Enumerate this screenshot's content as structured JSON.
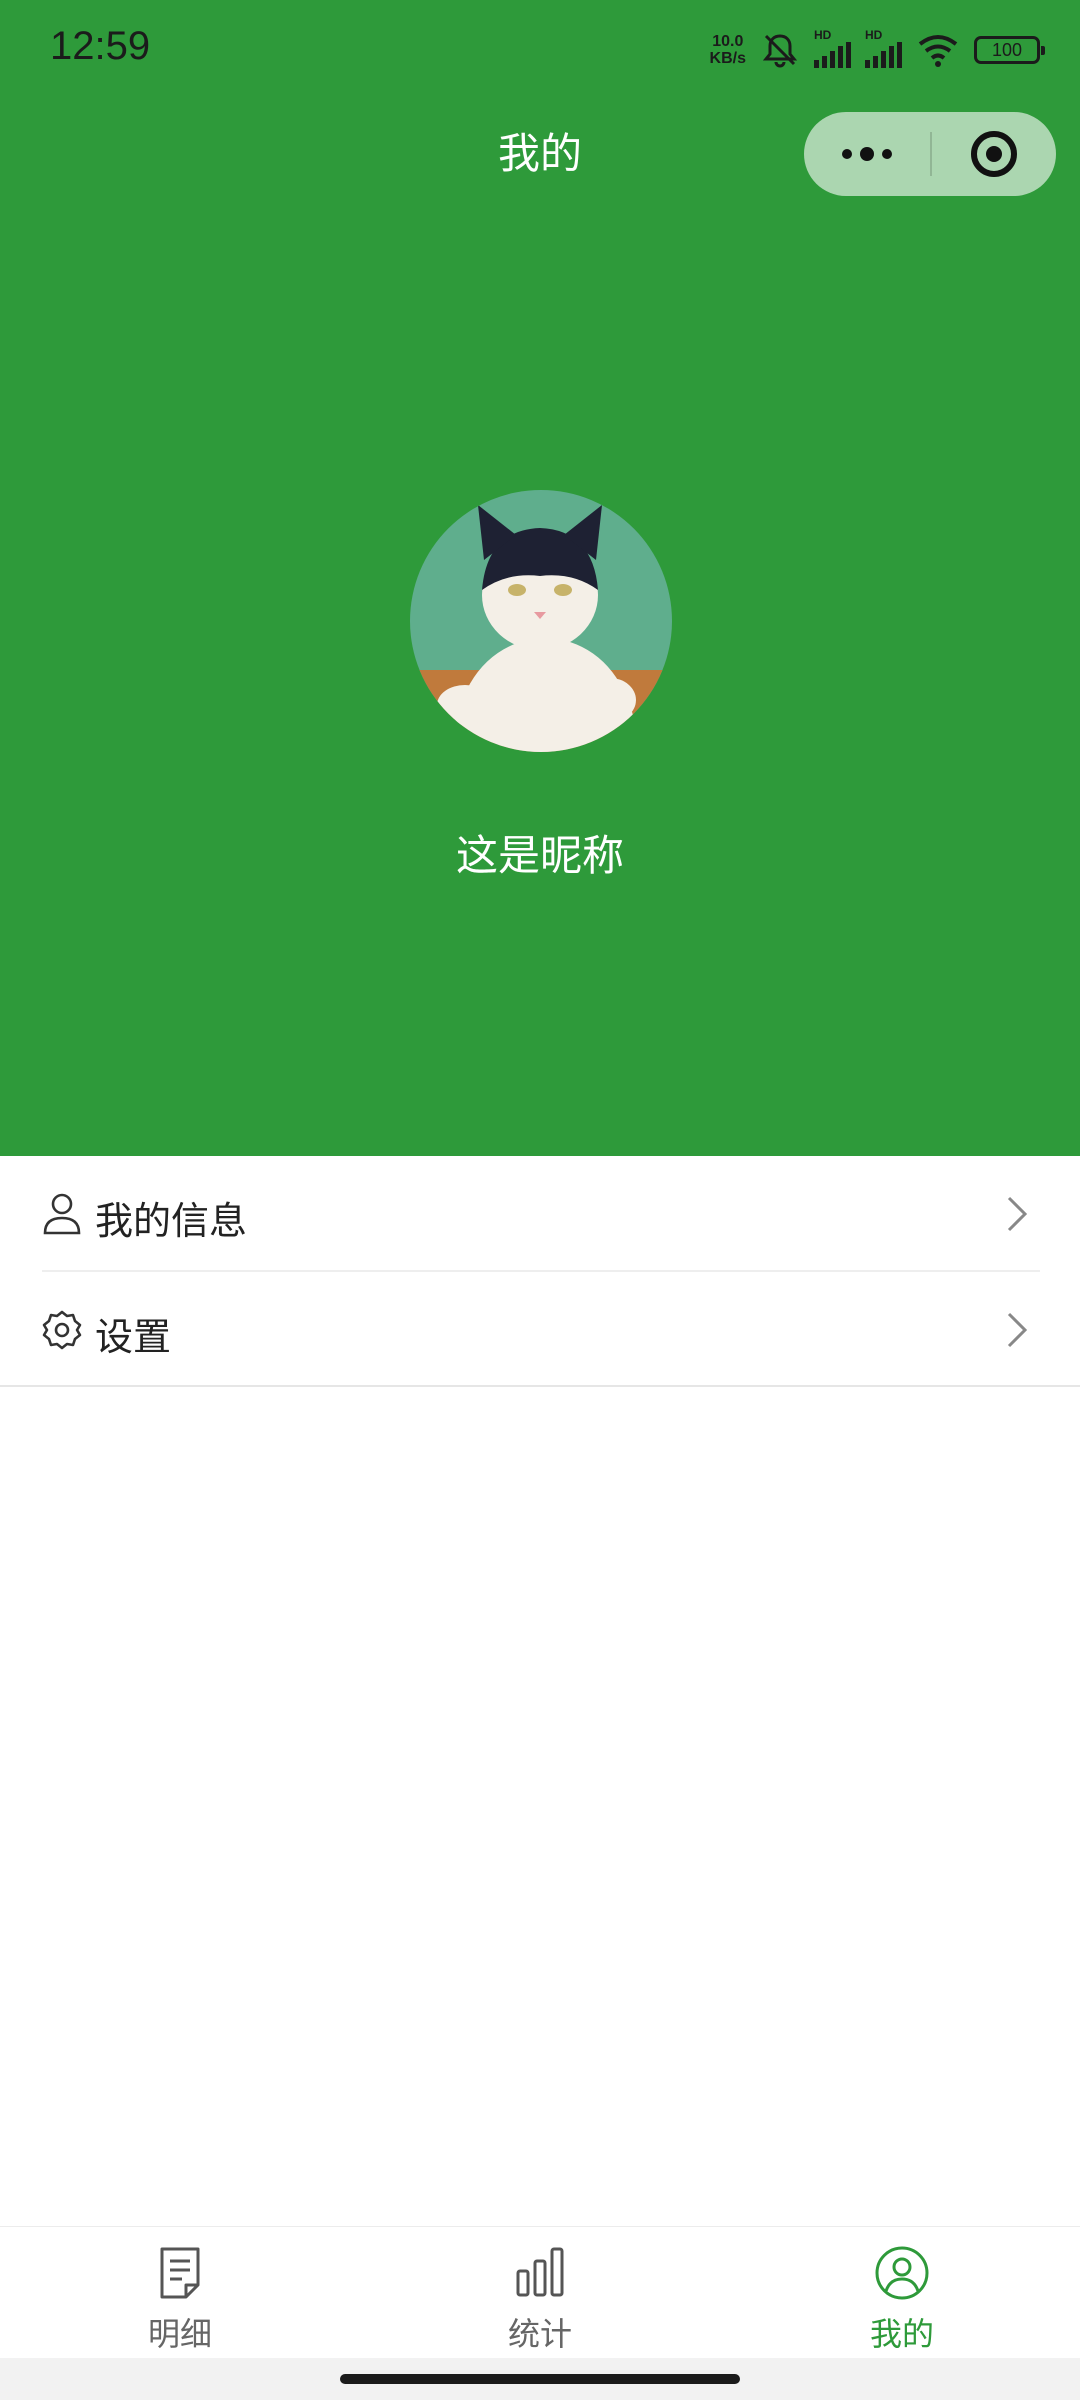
{
  "status_bar": {
    "time": "12:59",
    "net_speed_value": "10.0",
    "net_speed_unit": "KB/s",
    "signal_1_label": "HD",
    "signal_2_label": "HD",
    "battery": "100",
    "icons": [
      "mute-icon",
      "signal-icon",
      "signal-icon",
      "wifi-icon",
      "battery-icon"
    ]
  },
  "nav": {
    "title": "我的",
    "capsule_icons": [
      "more-dots-icon",
      "target-icon"
    ]
  },
  "profile": {
    "avatar_icon": "cat-avatar-image",
    "nickname": "这是昵称"
  },
  "menu": {
    "items": [
      {
        "label": "我的信息",
        "icon": "user-icon"
      },
      {
        "label": "设置",
        "icon": "gear-icon"
      }
    ],
    "arrow_icon": "chevron-right-icon"
  },
  "tabbar": {
    "items": [
      {
        "label": "明细",
        "icon": "document-icon",
        "active": false
      },
      {
        "label": "统计",
        "icon": "bar-chart-icon",
        "active": false
      },
      {
        "label": "我的",
        "icon": "user-circle-icon",
        "active": true
      }
    ]
  },
  "colors": {
    "primary": "#2e9a3a",
    "tab_active": "#2e9a3a",
    "tab_inactive": "#666666",
    "background": "#ffffff"
  }
}
